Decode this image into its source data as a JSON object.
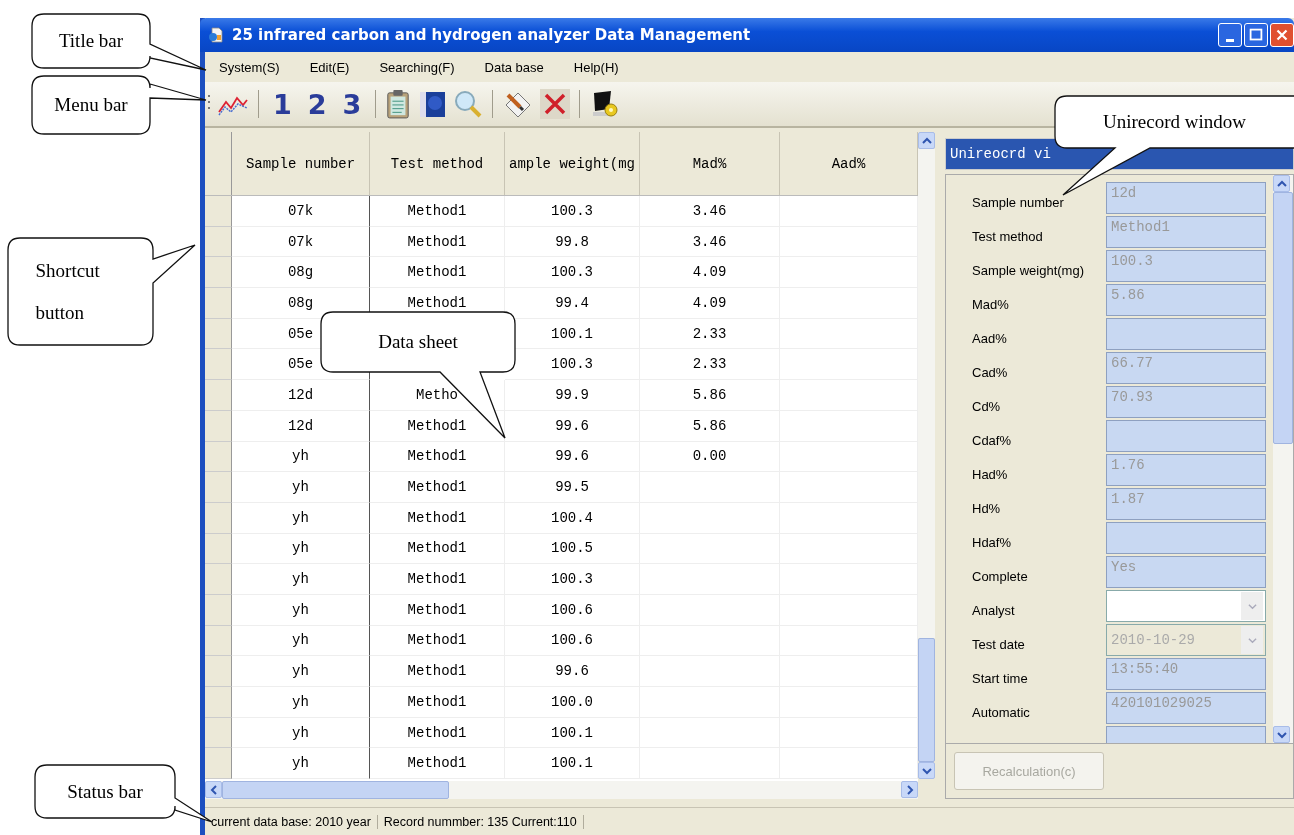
{
  "window": {
    "title": "25 infrared carbon and hydrogen analyzer Data Management"
  },
  "menu": [
    "System(S)",
    "Edit(E)",
    "Searching(F)",
    "Data base",
    "Help(H)"
  ],
  "toolbar_labels": [
    "1",
    "2",
    "3"
  ],
  "table": {
    "columns": [
      "Sample number",
      "Test method",
      "ample weight(mg",
      "Mad%",
      "Aad%"
    ],
    "rows": [
      {
        "sample_number": "07k",
        "test_method": "Method1",
        "sample_weight": "100.3",
        "mad": "3.46"
      },
      {
        "sample_number": "07k",
        "test_method": "Method1",
        "sample_weight": "99.8",
        "mad": "3.46"
      },
      {
        "sample_number": "08g",
        "test_method": "Method1",
        "sample_weight": "100.3",
        "mad": "4.09"
      },
      {
        "sample_number": "08g",
        "test_method": "Method1",
        "sample_weight": "99.4",
        "mad": "4.09"
      },
      {
        "sample_number": "05e",
        "sample_weight": "100.1",
        "mad": "2.33"
      },
      {
        "sample_number": "05e",
        "sample_weight": "100.3",
        "mad": "2.33"
      },
      {
        "sample_number": "12d",
        "test_method": "Metho",
        "sample_weight": "99.9",
        "mad": "5.86"
      },
      {
        "sample_number": "12d",
        "test_method": "Method1",
        "sample_weight": "99.6",
        "mad": "5.86"
      },
      {
        "sample_number": "yh",
        "test_method": "Method1",
        "sample_weight": "99.6",
        "mad": "0.00"
      },
      {
        "sample_number": "yh",
        "test_method": "Method1",
        "sample_weight": "99.5"
      },
      {
        "sample_number": "yh",
        "test_method": "Method1",
        "sample_weight": "100.4"
      },
      {
        "sample_number": "yh",
        "test_method": "Method1",
        "sample_weight": "100.5"
      },
      {
        "sample_number": "yh",
        "test_method": "Method1",
        "sample_weight": "100.3"
      },
      {
        "sample_number": "yh",
        "test_method": "Method1",
        "sample_weight": "100.6"
      },
      {
        "sample_number": "yh",
        "test_method": "Method1",
        "sample_weight": "100.6"
      },
      {
        "sample_number": "yh",
        "test_method": "Method1",
        "sample_weight": "99.6"
      },
      {
        "sample_number": "yh",
        "test_method": "Method1",
        "sample_weight": "100.0"
      },
      {
        "sample_number": "yh",
        "test_method": "Method1",
        "sample_weight": "100.1"
      },
      {
        "sample_number": "yh",
        "test_method": "Method1",
        "sample_weight": "100.1"
      }
    ]
  },
  "record_view": {
    "title": "Unireocrd vi",
    "fields": [
      {
        "label": "Sample number",
        "kind": "text",
        "disabled": true,
        "value": "12d"
      },
      {
        "label": "Test method",
        "kind": "text",
        "disabled": true,
        "value": "Method1"
      },
      {
        "label": "Sample weight(mg)",
        "kind": "text",
        "disabled": true,
        "value": "100.3"
      },
      {
        "label": "Mad%",
        "kind": "text",
        "disabled": true,
        "value": "5.86"
      },
      {
        "label": "Aad%",
        "kind": "text",
        "disabled": true
      },
      {
        "label": "Cad%",
        "kind": "text",
        "disabled": true,
        "value": "66.77"
      },
      {
        "label": "Cd%",
        "kind": "text",
        "disabled": true,
        "value": "70.93"
      },
      {
        "label": "Cdaf%",
        "kind": "text",
        "disabled": true
      },
      {
        "label": "Had%",
        "kind": "text",
        "disabled": true,
        "value": "1.76"
      },
      {
        "label": "Hd%",
        "kind": "text",
        "disabled": true,
        "value": "1.87"
      },
      {
        "label": "Hdaf%",
        "kind": "text",
        "disabled": true
      },
      {
        "label": "Complete",
        "kind": "text",
        "disabled": true,
        "value": "Yes"
      },
      {
        "label": "Analyst",
        "kind": "combo",
        "disabled": false
      },
      {
        "label": "Test date",
        "kind": "combo",
        "disabled": true,
        "value": "2010-10-29"
      },
      {
        "label": "Start time",
        "kind": "text",
        "disabled": true,
        "value": "13:55:40"
      },
      {
        "label": "Automatic",
        "kind": "text",
        "disabled": true,
        "value": "420101029025"
      },
      {
        "kind": "text",
        "disabled": true
      }
    ],
    "button": {
      "label": "Recalculation(c)",
      "disabled": true
    }
  },
  "status_bar": [
    "current data base: 2010 year",
    "Record nummber: 135 Current:110"
  ],
  "callouts": [
    "Title bar",
    "Menu bar",
    "Shortcut button",
    "Data sheet",
    "Unirecord window",
    "Status bar"
  ]
}
